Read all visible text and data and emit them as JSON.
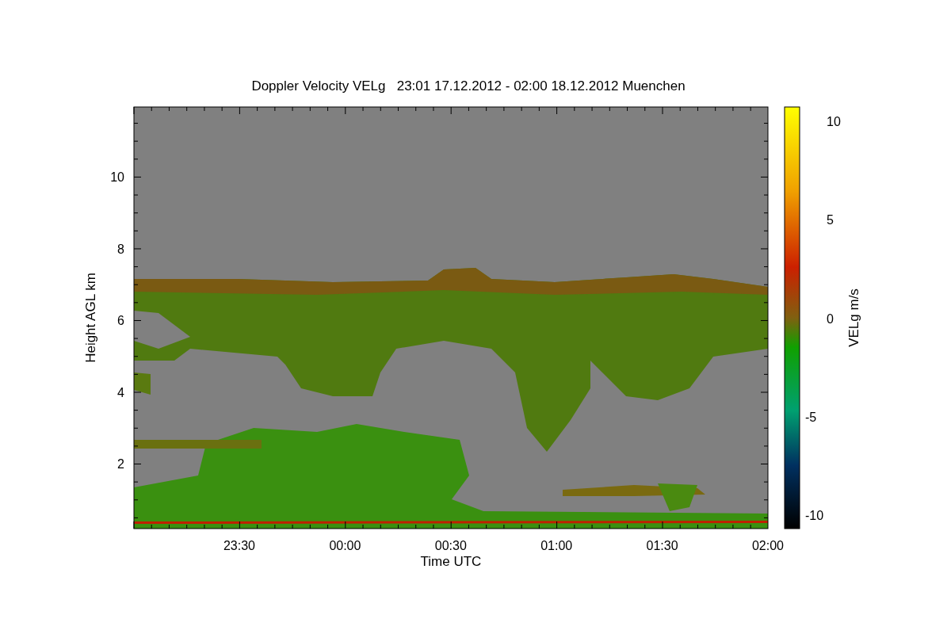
{
  "title": "Doppler Velocity VELg   23:01 17.12.2012 - 02:00 18.12.2012 Muenchen",
  "y_axis": {
    "label": "Height AGL km",
    "ticks": [
      "10",
      "8",
      "6",
      "4",
      "2"
    ]
  },
  "x_axis": {
    "label": "Time UTC",
    "ticks": [
      "23:30",
      "00:00",
      "00:30",
      "01:00",
      "01:30",
      "02:00"
    ]
  },
  "colorbar": {
    "label": "VELg m/s",
    "ticks": [
      "10",
      "5",
      "0",
      "-5",
      "-10"
    ]
  }
}
